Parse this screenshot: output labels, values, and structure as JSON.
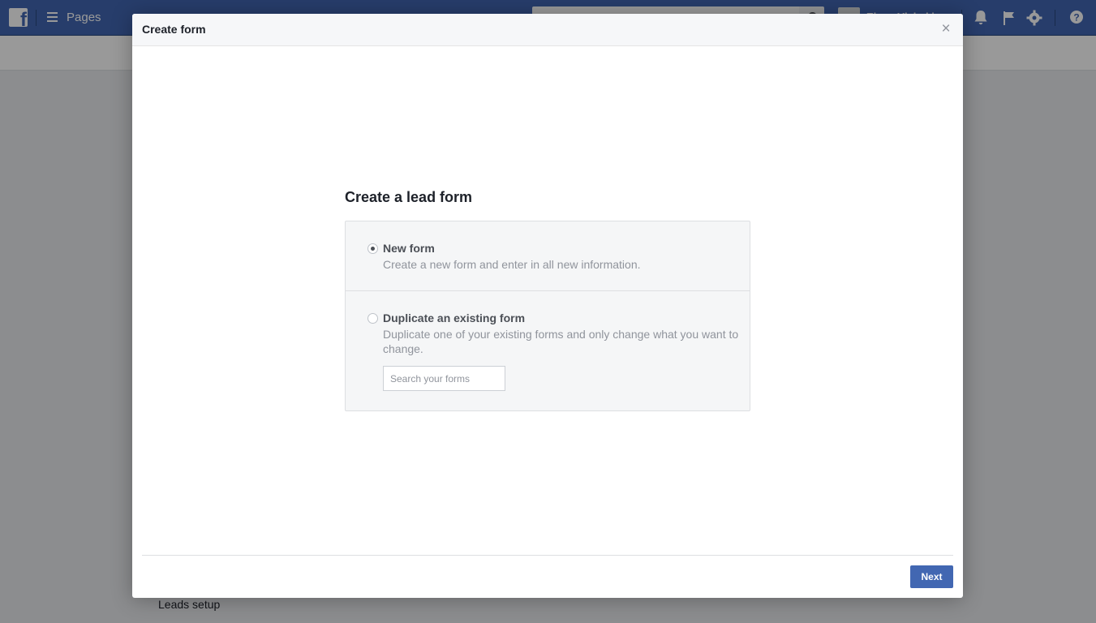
{
  "topbar": {
    "brand": "f",
    "section_label": "Pages",
    "profile_name": "Elena Vlahaki"
  },
  "background": {
    "sidebar_item": "Leads setup"
  },
  "dialog": {
    "title": "Create form",
    "close_symbol": "×",
    "heading": "Create a lead form",
    "options": [
      {
        "title": "New form",
        "description": "Create a new form and enter in all new information.",
        "selected": true
      },
      {
        "title": "Duplicate an existing form",
        "description": "Duplicate one of your existing forms and only change what you want to change.",
        "selected": false
      }
    ],
    "search_placeholder": "Search your forms",
    "next_label": "Next"
  },
  "colors": {
    "topbar": "#4267b2",
    "primary_button": "#4267b2",
    "overlay": "rgba(0,0,0,0.4)"
  },
  "icons": [
    "menu-icon",
    "search-icon",
    "notifications-icon",
    "flag-icon",
    "settings-icon",
    "help-icon",
    "close-icon",
    "radio-icon"
  ]
}
